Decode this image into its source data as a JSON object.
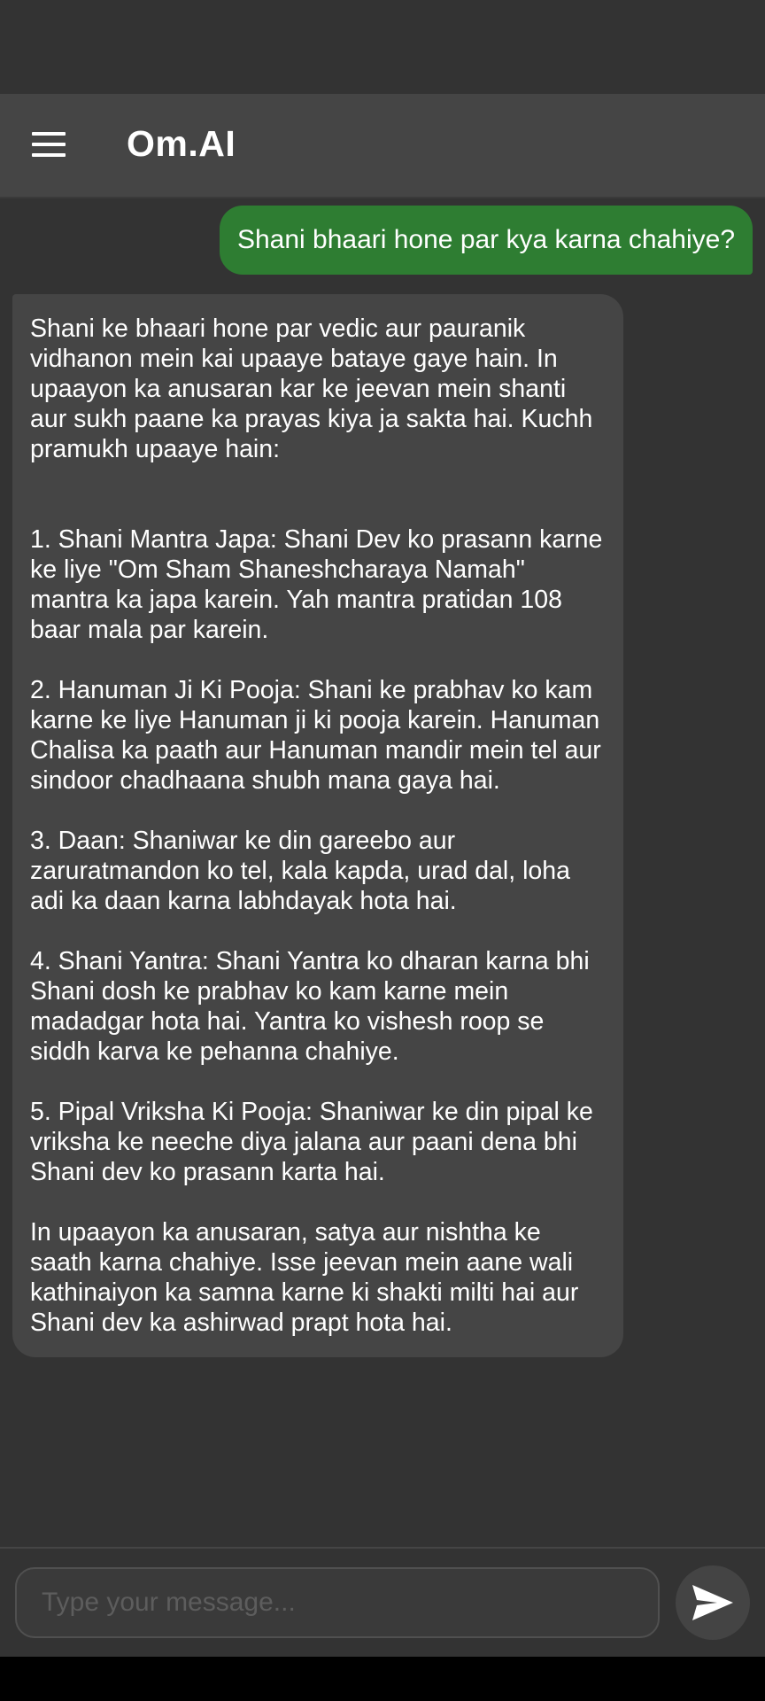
{
  "app": {
    "title": "Om.AI"
  },
  "icons": {
    "menu": "hamburger-menu-icon",
    "send": "send-arrow-icon"
  },
  "colors": {
    "background": "#333333",
    "app_bar": "#454545",
    "user_bubble": "#2e7d32",
    "bot_bubble": "#454545"
  },
  "chat": {
    "messages": [
      {
        "role": "user",
        "text": "Shani bhaari hone par kya karna chahiye?"
      },
      {
        "role": "bot",
        "text": "Shani ke bhaari hone par vedic aur pauranik vidhanon mein kai upaaye bataye gaye hain. In upaayon ka anusaran kar ke jeevan mein shanti aur sukh paane ka prayas kiya ja sakta hai. Kuchh pramukh upaaye hain:\n\n\n1. Shani Mantra Japa: Shani Dev ko prasann karne ke liye \"Om Sham Shaneshcharaya Namah\" mantra ka japa karein. Yah mantra pratidan 108 baar mala par karein.\n\n2. Hanuman Ji Ki Pooja: Shani ke prabhav ko kam karne ke liye Hanuman ji ki pooja karein. Hanuman Chalisa ka paath aur Hanuman mandir mein tel aur sindoor chadhaana shubh mana gaya hai.\n\n3. Daan: Shaniwar ke din gareebo aur zaruratmandon ko tel, kala kapda, urad dal, loha adi ka daan karna labhdayak hota hai.\n\n4. Shani Yantra: Shani Yantra ko dharan karna bhi Shani dosh ke prabhav ko kam karne mein madadgar hota hai. Yantra ko vishesh roop se siddh karva ke pehanna chahiye.\n\n5. Pipal Vriksha Ki Pooja: Shaniwar ke din pipal ke vriksha ke neeche diya jalana aur paani dena bhi Shani dev ko prasann karta hai.\n\nIn upaayon ka anusaran, satya aur nishtha ke saath karna chahiye. Isse jeevan mein aane wali kathinaiyon ka samna karne ki shakti milti hai aur Shani dev ka ashirwad prapt hota hai."
      }
    ]
  },
  "composer": {
    "placeholder": "Type your message...",
    "value": ""
  }
}
